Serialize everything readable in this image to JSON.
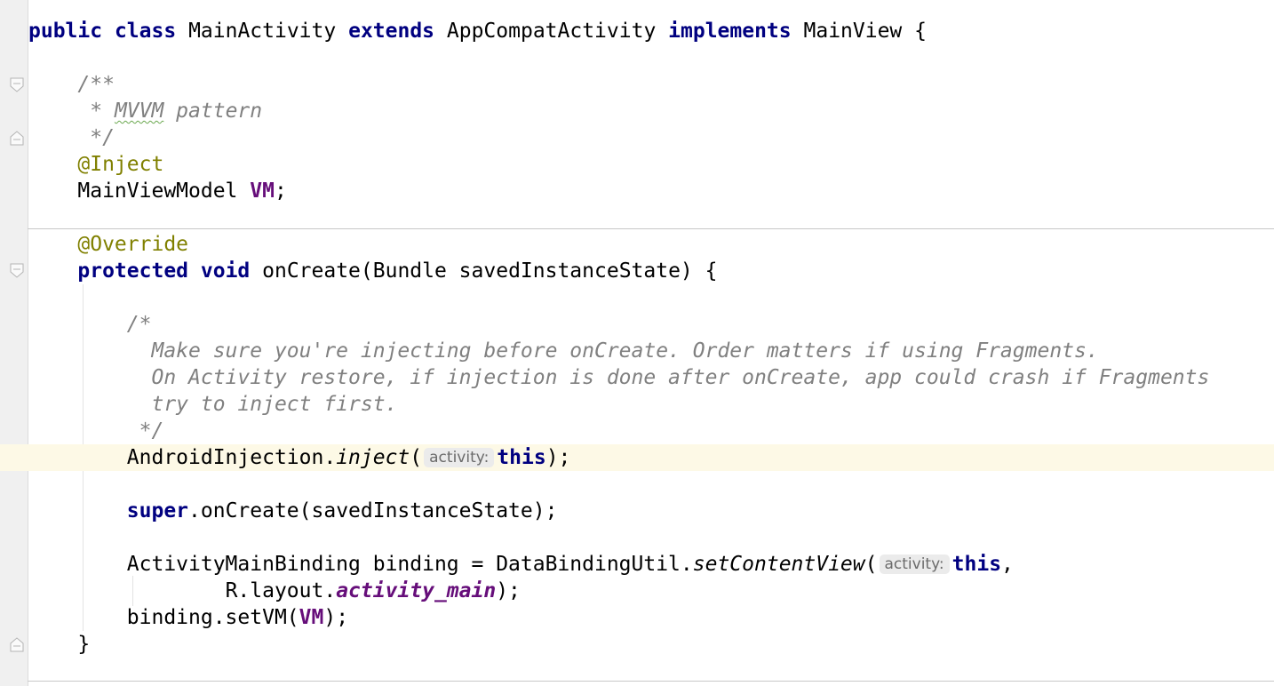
{
  "editor": {
    "caret_line": "AndroidInjection.inject(activity: this);",
    "code": {
      "kw_public": "public",
      "kw_class": "class",
      "class_name": "MainActivity",
      "kw_extends": "extends",
      "super_class": "AppCompatActivity",
      "kw_implements": "implements",
      "interface_name": "MainView",
      "open_brace": "{",
      "javadoc_open": "/**",
      "javadoc_star": " * ",
      "javadoc_mvvm": "MVVM",
      "javadoc_pattern": " pattern",
      "javadoc_close": " */",
      "ann_inject": "@Inject",
      "type_mainviewmodel": "MainViewModel",
      "field_vm": "VM",
      "semicolon": ";",
      "ann_override": "@Override",
      "kw_protected": "protected",
      "kw_void": "void",
      "method_oncreate_sig": "onCreate(Bundle savedInstanceState) {",
      "comment_open": "/*",
      "comment_line1": "  Make sure you're injecting before onCreate. Order matters if using Fragments.",
      "comment_line2": "  On Activity restore, if injection is done after onCreate, app could crash if Fragments",
      "comment_line3": "  try to inject first.",
      "comment_close": " */",
      "android_injection": "AndroidInjection.",
      "inject_method": "inject",
      "open_paren": "(",
      "param_hint_activity": "activity:",
      "kw_this": "this",
      "close_paren_semi": ");",
      "kw_super": "super",
      "super_oncreate_call": ".onCreate(savedInstanceState);",
      "binding_decl": "ActivityMainBinding binding = DataBindingUtil.",
      "setcontentview_method": "setContentView",
      "comma": ",",
      "r_layout": "R.layout.",
      "activity_main_field": "activity_main",
      "binding_setvm": "binding.setVM(",
      "close_brace": "}"
    }
  },
  "colors": {
    "keyword": "#000080",
    "comment": "#808080",
    "annotation": "#808000",
    "field": "#660e7a",
    "caret_line_bg": "#fdf9e6"
  }
}
